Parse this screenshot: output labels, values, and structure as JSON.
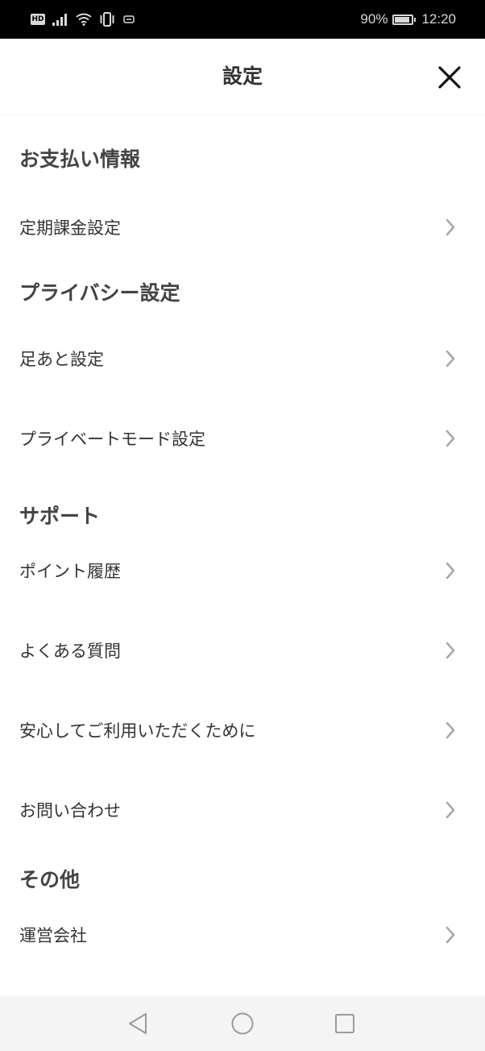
{
  "status_bar": {
    "hd_badge": "HD",
    "battery_percent": "90%",
    "battery_level": 0.9,
    "time": "12:20",
    "icons": [
      "hd-icon",
      "signal-icon",
      "wifi-icon",
      "vibrate-icon",
      "notification-icon",
      "battery-icon"
    ]
  },
  "header": {
    "title": "設定",
    "close_icon": "close-icon"
  },
  "sections": [
    {
      "heading": "お支払い情報",
      "items": [
        {
          "label": "定期課金設定"
        }
      ]
    },
    {
      "heading": "プライバシー設定",
      "items": [
        {
          "label": "足あと設定"
        },
        {
          "label": "プライベートモード設定"
        }
      ]
    },
    {
      "heading": "サポート",
      "items": [
        {
          "label": "ポイント履歴"
        },
        {
          "label": "よくある質問"
        },
        {
          "label": "安心してご利用いただくために"
        },
        {
          "label": "お問い合わせ"
        }
      ]
    },
    {
      "heading": "その他",
      "items": [
        {
          "label": "運営会社"
        }
      ]
    }
  ],
  "nav_bar": {
    "icons": [
      "back-triangle-icon",
      "home-circle-icon",
      "recents-square-icon"
    ]
  },
  "colors": {
    "status_bar_bg": "#000000",
    "text_primary": "#333333",
    "heading_text": "#444444",
    "chevron": "#a8a8a8",
    "nav_bar_bg": "#f4f4f4"
  }
}
